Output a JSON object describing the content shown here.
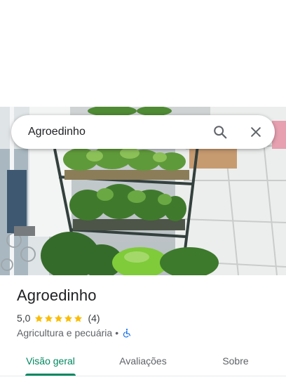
{
  "search": {
    "query": "Agroedinho",
    "search_icon": "search-icon",
    "close_icon": "close-icon"
  },
  "photo": {
    "subject": "place-photo",
    "colors": {
      "plant_dark": "#2f5e23",
      "plant_light": "#6fae3e",
      "floor": "#e9ebea",
      "wall": "#f2f3f4",
      "shelf": "#3a3f3d"
    }
  },
  "place": {
    "name": "Agroedinho",
    "rating": "5,0",
    "stars": 5,
    "review_count": "(4)",
    "category": "Agricultura e pecuária",
    "separator": "•",
    "accessibility_icon": "wheelchair-icon"
  },
  "tabs": [
    {
      "label": "Visão geral",
      "active": true
    },
    {
      "label": "Avaliações",
      "active": false
    },
    {
      "label": "Sobre",
      "active": false
    }
  ],
  "colors": {
    "accent": "#01875f",
    "star": "#fbbc04",
    "accessibility": "#1a73e8",
    "text_primary": "#202124",
    "text_secondary": "#5f6368"
  }
}
